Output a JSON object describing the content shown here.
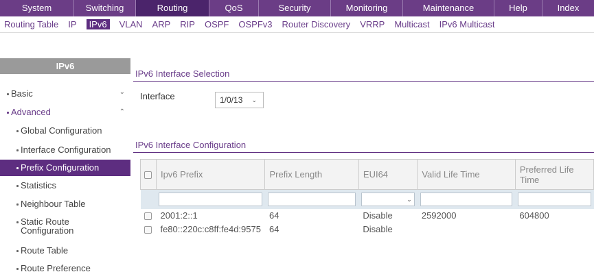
{
  "topnav": {
    "items": [
      {
        "label": "System"
      },
      {
        "label": "Switching"
      },
      {
        "label": "Routing"
      },
      {
        "label": "QoS"
      },
      {
        "label": "Security"
      },
      {
        "label": "Monitoring"
      },
      {
        "label": "Maintenance"
      },
      {
        "label": "Help"
      },
      {
        "label": "Index"
      }
    ],
    "active": "Routing"
  },
  "subnav": {
    "items": [
      {
        "label": "Routing Table"
      },
      {
        "label": "IP"
      },
      {
        "label": "IPv6"
      },
      {
        "label": "VLAN"
      },
      {
        "label": "ARP"
      },
      {
        "label": "RIP"
      },
      {
        "label": "OSPF"
      },
      {
        "label": "OSPFv3"
      },
      {
        "label": "Router Discovery"
      },
      {
        "label": "VRRP"
      },
      {
        "label": "Multicast"
      },
      {
        "label": "IPv6 Multicast"
      }
    ],
    "active": "IPv6"
  },
  "sidebar": {
    "title": "IPv6",
    "items": [
      {
        "label": "Basic"
      },
      {
        "label": "Advanced"
      },
      {
        "label": "Global Configuration"
      },
      {
        "label": "Interface Configuration"
      },
      {
        "label": "Prefix Configuration"
      },
      {
        "label": "Statistics"
      },
      {
        "label": "Neighbour Table"
      },
      {
        "label": "Static Route"
      },
      {
        "label": "Configuration"
      },
      {
        "label": "Route Table"
      },
      {
        "label": "Route Preference"
      }
    ]
  },
  "selection": {
    "title": "IPv6 Interface Selection",
    "interface_label": "Interface",
    "interface_value": "1/0/13"
  },
  "config": {
    "title": "IPv6 Interface Configuration",
    "columns": [
      "Ipv6 Prefix",
      "Prefix Length",
      "EUI64",
      "Valid Life Time",
      "Preferred Life Time"
    ],
    "rows": [
      {
        "prefix": "2001:2::1",
        "length": "64",
        "eui64": "Disable",
        "valid": "2592000",
        "preferred": "604800"
      },
      {
        "prefix": "fe80::220c:c8ff:fe4d:9575",
        "length": "64",
        "eui64": "Disable",
        "valid": "",
        "preferred": ""
      }
    ]
  },
  "colors": {
    "brand": "#6b3d86",
    "active": "#4b246b",
    "selected": "#5d2d80"
  }
}
